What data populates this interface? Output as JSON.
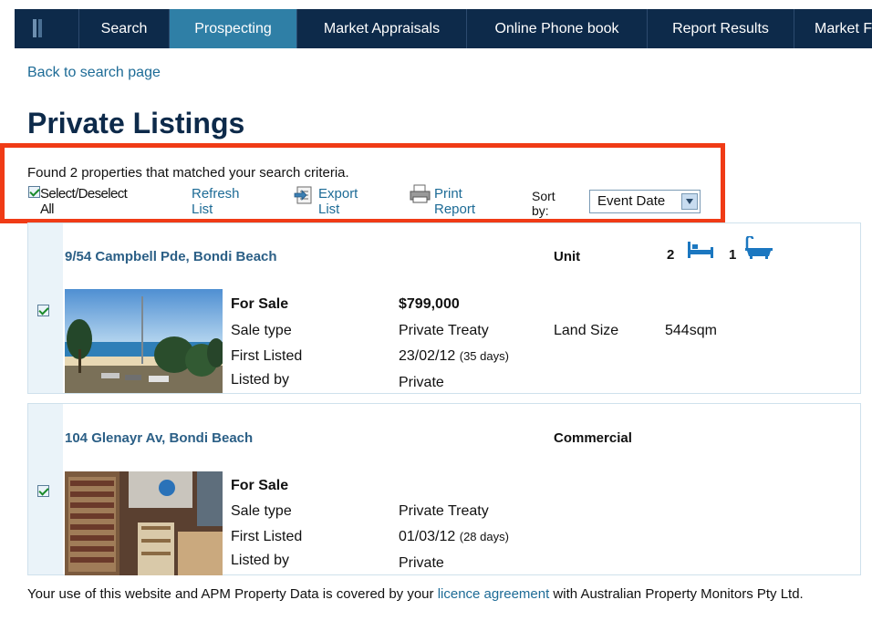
{
  "nav": {
    "tabs": [
      "Search",
      "Prospecting",
      "Market Appraisals",
      "Online Phone book",
      "Report Results",
      "Market F"
    ]
  },
  "back_link": "Back to search page",
  "page_title": "Private Listings",
  "results": {
    "found_text": "Found 2 properties that matched your search criteria.",
    "select_all_label": "Select/Deselect All",
    "refresh_label": "Refresh List",
    "export_label": "Export List",
    "print_label": "Print Report",
    "sort_label": "Sort by:",
    "sort_value": "Event Date"
  },
  "listings": [
    {
      "address": "9/54 Campbell Pde, Bondi Beach",
      "property_type": "Unit",
      "bedrooms": "2",
      "bathrooms": "1",
      "status": "For Sale",
      "price": "$799,000",
      "sale_type_label": "Sale type",
      "sale_type": "Private Treaty",
      "land_size_label": "Land Size",
      "land_size": "544sqm",
      "first_listed_label": "First Listed",
      "first_listed_date": "23/02/12",
      "first_listed_days": "(35 days)",
      "listed_by_label": "Listed by",
      "listed_by": "Private"
    },
    {
      "address": "104 Glenayr Av, Bondi Beach",
      "property_type": "Commercial",
      "status": "For Sale",
      "sale_type_label": "Sale type",
      "sale_type": "Private Treaty",
      "first_listed_label": "First Listed",
      "first_listed_date": "01/03/12",
      "first_listed_days": "(28 days)",
      "listed_by_label": "Listed by",
      "listed_by": "Private"
    }
  ],
  "footer": {
    "text_before": "Your use of this website and APM Property Data is covered by your ",
    "link": "licence agreement",
    "text_after": " with Australian Property Monitors Pty Ltd."
  },
  "colors": {
    "nav_bg": "#0d2a4a",
    "nav_active": "#2f7fa6",
    "link": "#1d6b96",
    "highlight_box": "#f03b16"
  },
  "icons": [
    "app-logo-icon",
    "checkbox-checked-icon",
    "export-icon",
    "print-icon",
    "dropdown-arrow-icon",
    "bed-icon",
    "bath-icon"
  ]
}
